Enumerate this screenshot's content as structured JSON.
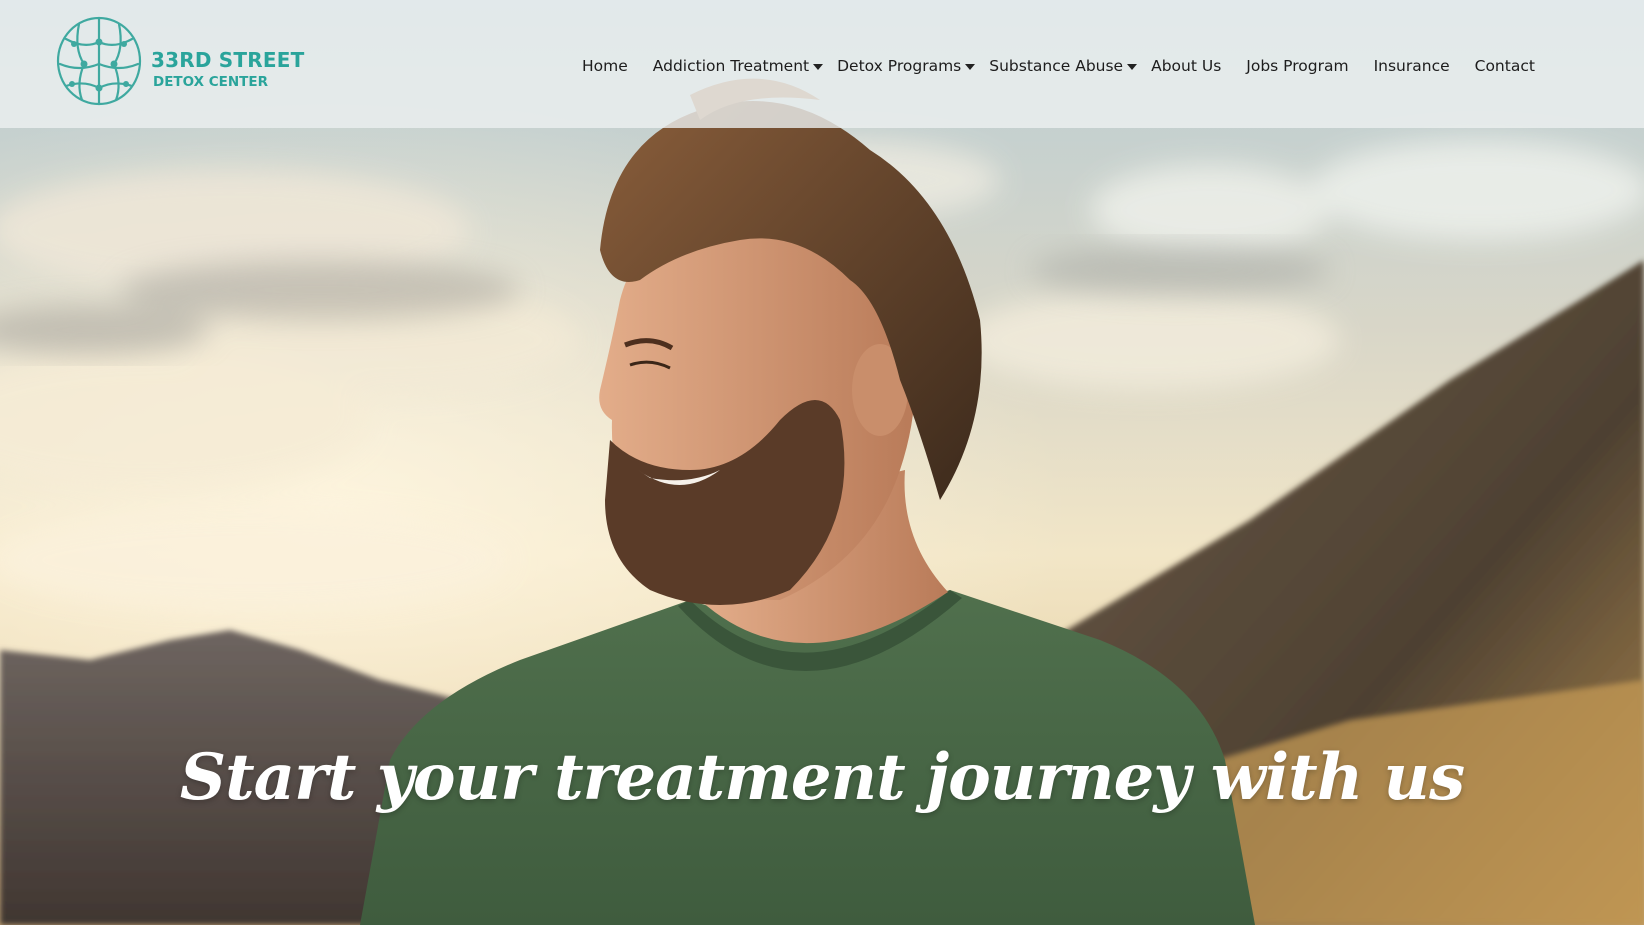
{
  "brand": {
    "name_line1": "33RD STREET",
    "name_line2": "DETOX CENTER",
    "accent_color": "#2aa49b",
    "logo_icon": "brain-network-icon"
  },
  "nav": {
    "items": [
      {
        "label": "Home",
        "has_dropdown": false
      },
      {
        "label": "Addiction Treatment",
        "has_dropdown": true
      },
      {
        "label": "Detox Programs",
        "has_dropdown": true
      },
      {
        "label": "Substance Abuse",
        "has_dropdown": true
      },
      {
        "label": "About Us",
        "has_dropdown": false
      },
      {
        "label": "Jobs Program",
        "has_dropdown": false
      },
      {
        "label": "Insurance",
        "has_dropdown": false
      },
      {
        "label": "Contact",
        "has_dropdown": false
      }
    ],
    "dropdown_icon": "caret-down-icon"
  },
  "hero": {
    "headline": "Start your treatment journey with us",
    "image": "smiling-bearded-man-outdoors-photo"
  }
}
